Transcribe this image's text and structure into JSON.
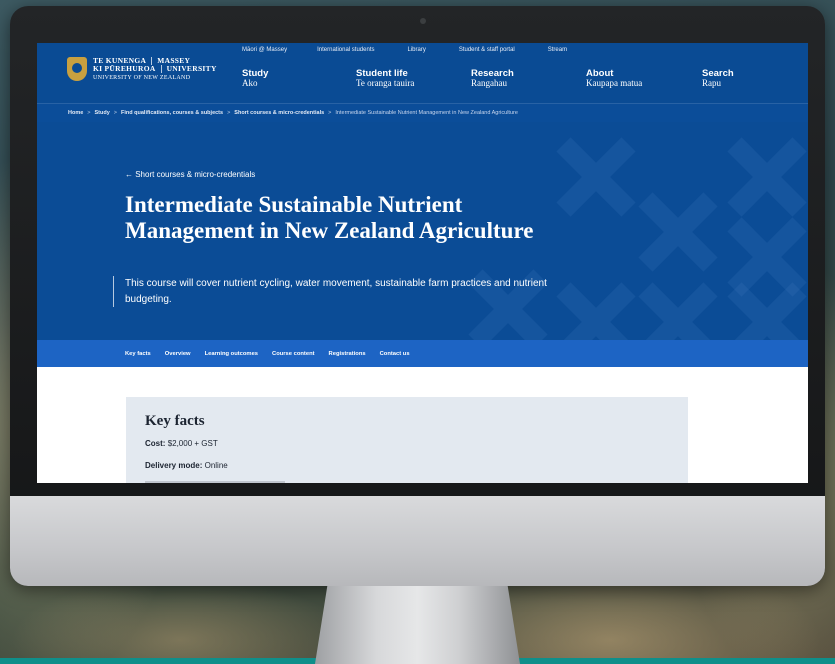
{
  "site": {
    "logo": {
      "line1_left": "TE KUNENGA",
      "line1_right": "MASSEY",
      "line2_left": "KI PŪREHUROA",
      "line2_right": "UNIVERSITY",
      "line3": "UNIVERSITY OF NEW ZEALAND"
    },
    "utility_links": [
      "Māori @ Massey",
      "International students",
      "Library",
      "Student & staff portal",
      "Stream"
    ],
    "main_nav": [
      {
        "en": "Study",
        "mi": "Ako"
      },
      {
        "en": "Student life",
        "mi": "Te oranga tauira"
      },
      {
        "en": "Research",
        "mi": "Rangahau"
      },
      {
        "en": "About",
        "mi": "Kaupapa matua"
      },
      {
        "en": "Search",
        "mi": "Rapu"
      }
    ]
  },
  "breadcrumb": {
    "items": [
      "Home",
      "Study",
      "Find qualifications, courses & subjects",
      "Short courses & micro-credentials"
    ],
    "current": "Intermediate Sustainable Nutrient Management in New Zealand Agriculture",
    "separator": ">"
  },
  "hero": {
    "back_link": "← Short courses & micro-credentials",
    "title": "Intermediate Sustainable Nutrient Management in New Zealand Agriculture",
    "description": "This course will cover nutrient cycling, water movement, sustainable farm practices and nutrient budgeting."
  },
  "tabs": [
    "Key facts",
    "Overview",
    "Learning outcomes",
    "Course content",
    "Registrations",
    "Contact us"
  ],
  "key_facts": {
    "heading": "Key facts",
    "cost_label": "Cost:",
    "cost_value": "$2,000 + GST",
    "delivery_label": "Delivery mode:",
    "delivery_value": "Online"
  },
  "colors": {
    "brand_blue": "#0a4b94",
    "tab_bar_blue": "#1d64c4",
    "card_bg": "#e3e9f0"
  }
}
